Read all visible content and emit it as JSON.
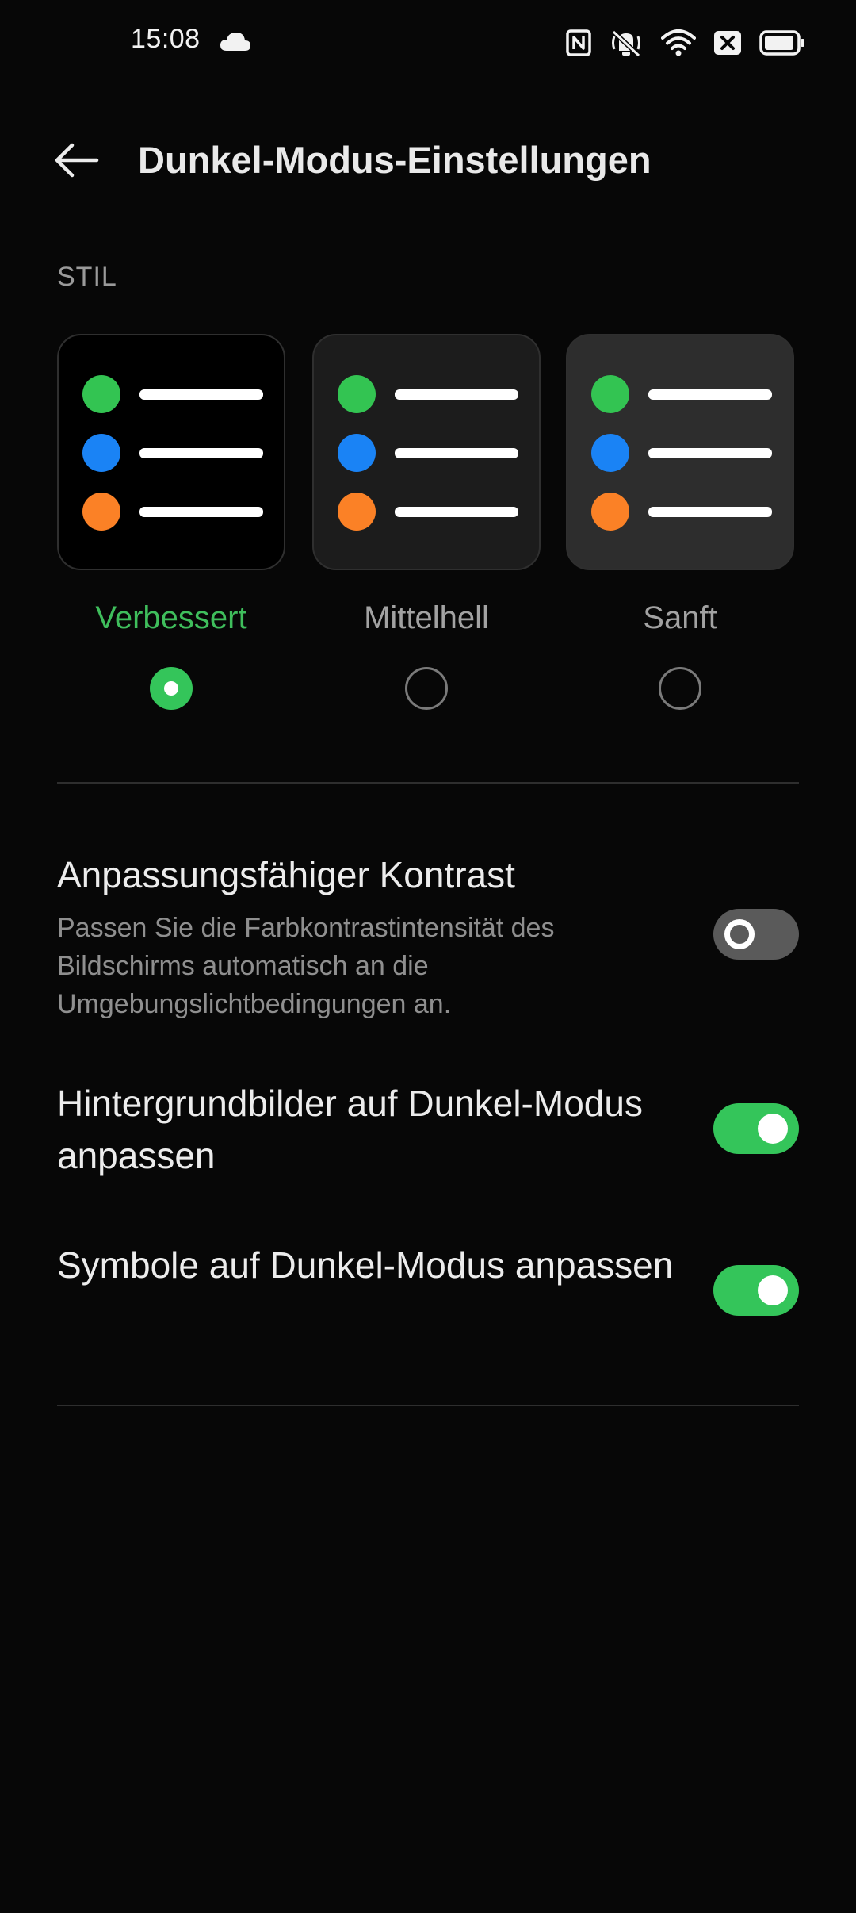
{
  "status_bar": {
    "time": "15:08",
    "icons": [
      "cloud-icon",
      "nfc-icon",
      "vibrate-mute-icon",
      "wifi-icon",
      "sim-off-icon",
      "battery-icon"
    ]
  },
  "header": {
    "title": "Dunkel-Modus-Einstellungen",
    "back_icon": "arrow-left-icon"
  },
  "style_section": {
    "label": "STIL",
    "options": [
      {
        "label": "Verbessert",
        "selected": true,
        "card_bg": "#000000"
      },
      {
        "label": "Mittelhell",
        "selected": false,
        "card_bg": "#1c1c1c"
      },
      {
        "label": "Sanft",
        "selected": false,
        "card_bg": "#2d2d2d"
      }
    ],
    "preview_dot_colors": [
      "#33c452",
      "#1a83f5",
      "#fb8126"
    ]
  },
  "settings": [
    {
      "title": "Anpassungsfähiger Kontrast",
      "description": "Passen Sie die Farbkontrastintensität des Bildschirms automatisch an die Umgebungslichtbedingungen an.",
      "enabled": false
    },
    {
      "title": "Hintergrundbilder auf Dunkel-Modus anpassen",
      "enabled": true
    },
    {
      "title": "Symbole auf Dunkel-Modus anpassen",
      "enabled": true
    }
  ],
  "colors": {
    "background": "#070707",
    "accent": "#34c55a",
    "accent_text": "#3fbe5c"
  }
}
